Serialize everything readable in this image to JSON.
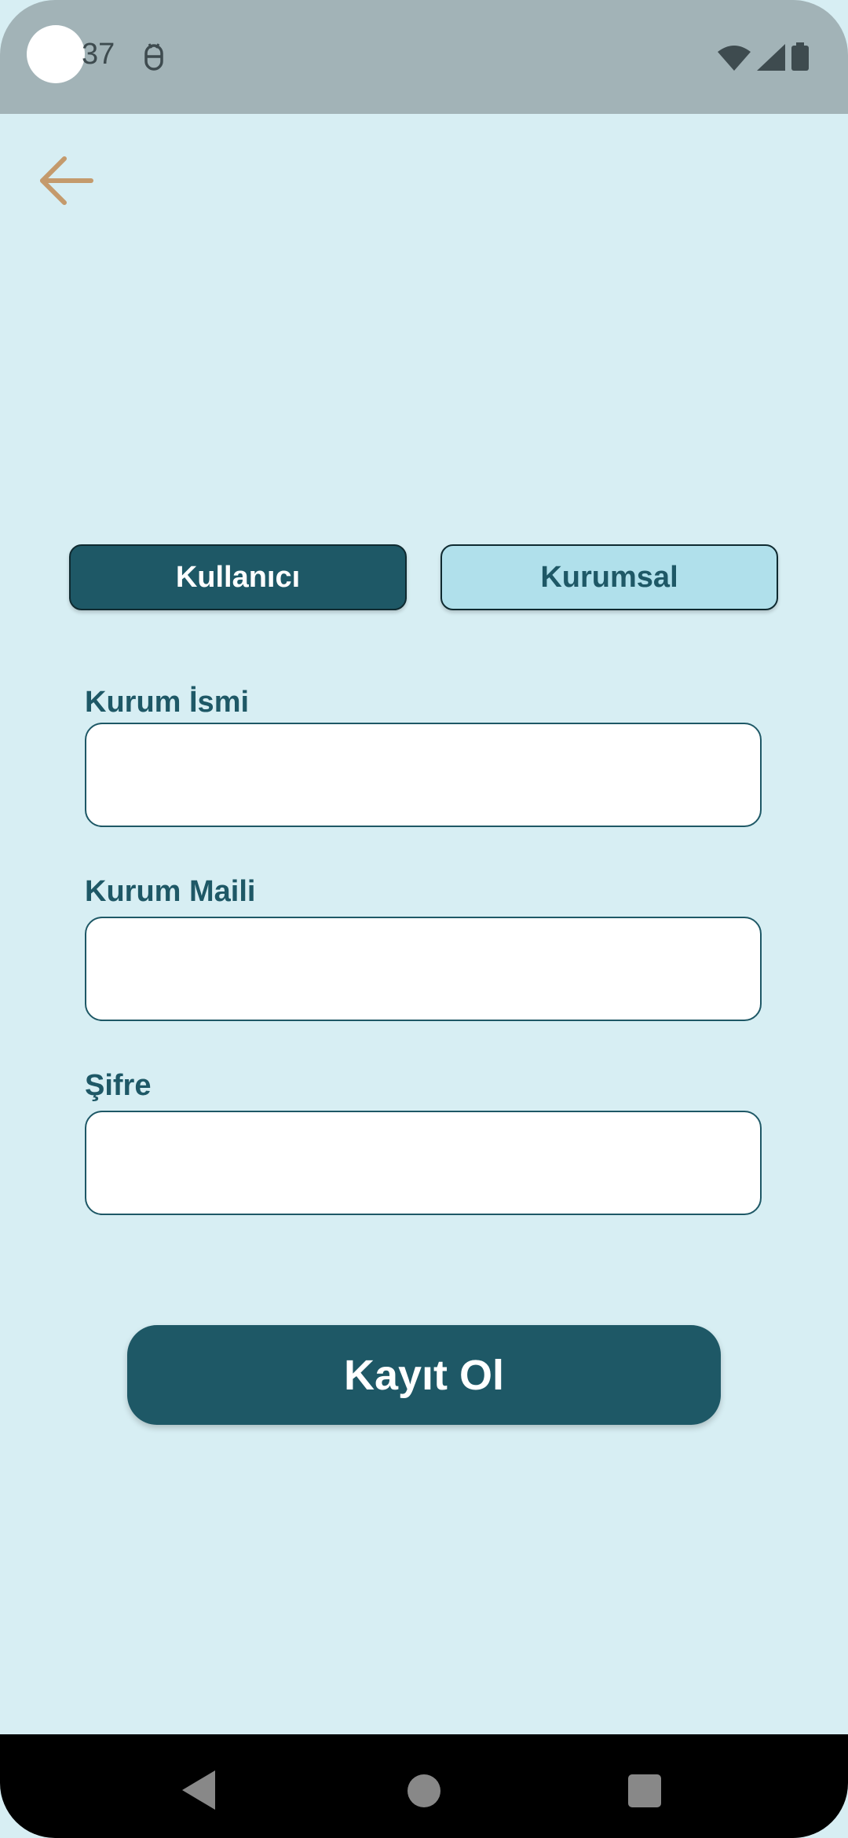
{
  "status_bar": {
    "time": "37",
    "app_icon": "android-debug-icon",
    "icons": [
      "wifi-icon",
      "signal-icon",
      "battery-icon"
    ]
  },
  "header": {
    "back_icon": "arrow-left-icon"
  },
  "tabs": [
    {
      "label": "Kullanıcı",
      "active": true
    },
    {
      "label": "Kurumsal",
      "active": false
    }
  ],
  "form": {
    "fields": [
      {
        "label": "Kurum İsmi",
        "value": "",
        "placeholder": ""
      },
      {
        "label": "Kurum Maili",
        "value": "",
        "placeholder": ""
      },
      {
        "label": "Şifre",
        "value": "",
        "placeholder": ""
      }
    ],
    "submit_label": "Kayıt Ol"
  },
  "colors": {
    "background": "#d7eef3",
    "primary": "#1e5866",
    "tab_inactive": "#b0e0eb",
    "back_arrow": "#c49a6c",
    "status_bar": "#a2b3b7"
  },
  "nav_bar": {
    "icons": [
      "nav-back-icon",
      "nav-home-icon",
      "nav-recents-icon"
    ]
  }
}
